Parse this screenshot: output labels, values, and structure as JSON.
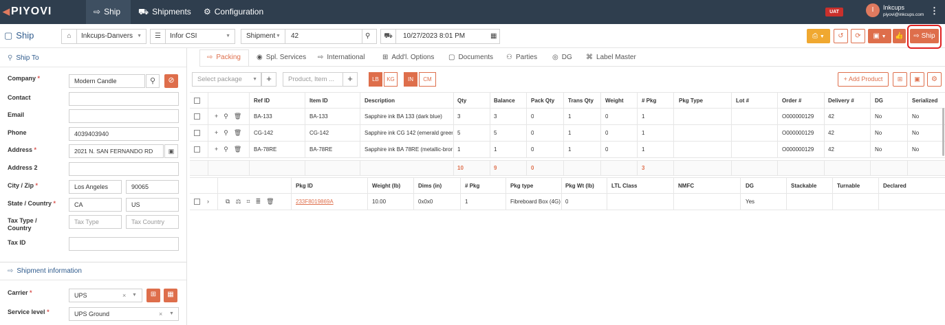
{
  "app": {
    "logo": "PIYOVI",
    "env_badge": "UAT"
  },
  "nav": {
    "items": [
      {
        "label": "Ship",
        "icon": "ship-icon"
      },
      {
        "label": "Shipments",
        "icon": "shipments-icon"
      },
      {
        "label": "Configuration",
        "icon": "gear-icon"
      }
    ],
    "user": {
      "initial": "I",
      "name": "Inkcups",
      "email": "piyovi@inkcups.com"
    }
  },
  "toolbar": {
    "title": "Ship",
    "location": "Inkcups-Danvers",
    "erp": "Infor CSI",
    "ref_type": "Shipment",
    "ref_value": "42",
    "datetime": "10/27/2023 8:01 PM",
    "ship_button": "Ship"
  },
  "ship_to": {
    "heading": "Ship To",
    "fields": {
      "company": {
        "label": "Company",
        "value": "Modern Candle"
      },
      "contact": {
        "label": "Contact",
        "value": ""
      },
      "email": {
        "label": "Email",
        "value": ""
      },
      "phone": {
        "label": "Phone",
        "value": "4039403940"
      },
      "address": {
        "label": "Address",
        "value": "2021 N. SAN FERNANDO RD"
      },
      "address2": {
        "label": "Address 2",
        "value": ""
      },
      "city_zip": {
        "label": "City / Zip",
        "city": "Los Angeles",
        "zip": "90065"
      },
      "state_country": {
        "label": "State / Country",
        "state": "CA",
        "country": "US"
      },
      "tax_type_country": {
        "label_line1": "Tax Type /",
        "label_line2": "Country",
        "type_placeholder": "Tax Type",
        "country_placeholder": "Tax Country"
      },
      "tax_id": {
        "label": "Tax ID",
        "value": ""
      }
    }
  },
  "shipment_info": {
    "heading": "Shipment information",
    "carrier": {
      "label": "Carrier",
      "value": "UPS"
    },
    "service_level": {
      "label": "Service level",
      "value": "UPS Ground"
    }
  },
  "tabs": [
    "Packing",
    "Spl. Services",
    "International",
    "Add'l. Options",
    "Documents",
    "Parties",
    "DG",
    "Label Master"
  ],
  "packing": {
    "select_package_placeholder": "Select package",
    "product_placeholder": "Product, Item ...",
    "units_weight": [
      "LB",
      "KG"
    ],
    "units_dim": [
      "IN",
      "CM"
    ],
    "add_product": "+ Add Product"
  },
  "products": {
    "headers": [
      "Ref ID",
      "Item ID",
      "Description",
      "Qty",
      "Balance",
      "Pack Qty",
      "Trans Qty",
      "Weight",
      "# Pkg",
      "Pkg Type",
      "Lot #",
      "Order #",
      "Delivery #",
      "DG",
      "Serialized"
    ],
    "rows": [
      [
        "BA-133",
        "BA-133",
        "Sapphire ink BA 133 (dark blue)",
        "3",
        "3",
        "0",
        "1",
        "0",
        "1",
        "",
        "",
        "O000000129",
        "42",
        "No",
        "No"
      ],
      [
        "CG-142",
        "CG-142",
        "Sapphire ink CG 142 (emerald green",
        "5",
        "5",
        "0",
        "1",
        "0",
        "1",
        "",
        "",
        "O000000129",
        "42",
        "No",
        "No"
      ],
      [
        "BA-78RE",
        "BA-78RE",
        "Sapphire ink BA 78RE (metallic-bron",
        "1",
        "1",
        "0",
        "1",
        "0",
        "1",
        "",
        "",
        "O000000129",
        "42",
        "No",
        "No"
      ]
    ],
    "totals": {
      "qty": "10",
      "balance": "9",
      "pack_qty": "0",
      "pkg": "3"
    }
  },
  "packages": {
    "headers": [
      "Pkg ID",
      "Weight (lb)",
      "Dims (in)",
      "# Pkg",
      "Pkg type",
      "Pkg Wt (lb)",
      "LTL Class",
      "NMFC",
      "DG",
      "Stackable",
      "Turnable",
      "Declared"
    ],
    "rows": [
      [
        "233F8019869A",
        "10.00",
        "0x0x0",
        "1",
        "Fibreboard Box (4G)",
        "0",
        "",
        "",
        "Yes",
        "",
        "",
        ""
      ]
    ]
  },
  "colors": {
    "accent": "#de6e4b",
    "nav_bg": "#2f3e4e",
    "title_blue": "#2e5a8c",
    "highlight": "#e02020"
  }
}
